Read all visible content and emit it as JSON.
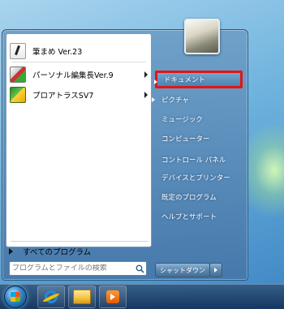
{
  "start_menu": {
    "programs": [
      {
        "label": "筆まめ Ver.23",
        "icon": "fude-icon",
        "has_submenu": false
      },
      {
        "label": "パーソナル編集長Ver.9",
        "icon": "personal-editor-icon",
        "has_submenu": true
      },
      {
        "label": "プロアトラスSV7",
        "icon": "pro-atlas-icon",
        "has_submenu": true
      }
    ],
    "all_programs_label": "すべてのプログラム",
    "search": {
      "placeholder": "プログラムとファイルの検索",
      "icon": "search-icon"
    },
    "right_items": [
      {
        "label": "ドキュメント",
        "highlighted": true
      },
      {
        "label": "ピクチャ"
      },
      {
        "label": "ミュージック"
      },
      {
        "label": "コンピューター"
      },
      {
        "label": "コントロール パネル"
      },
      {
        "label": "デバイスとプリンター"
      },
      {
        "label": "既定のプログラム"
      },
      {
        "label": "ヘルプとサポート"
      }
    ],
    "shutdown_label": "シャットダウン",
    "highlight_color": "#e21515"
  },
  "taskbar": {
    "items": [
      "start-orb",
      "internet-explorer-icon",
      "explorer-icon",
      "media-player-icon"
    ]
  }
}
